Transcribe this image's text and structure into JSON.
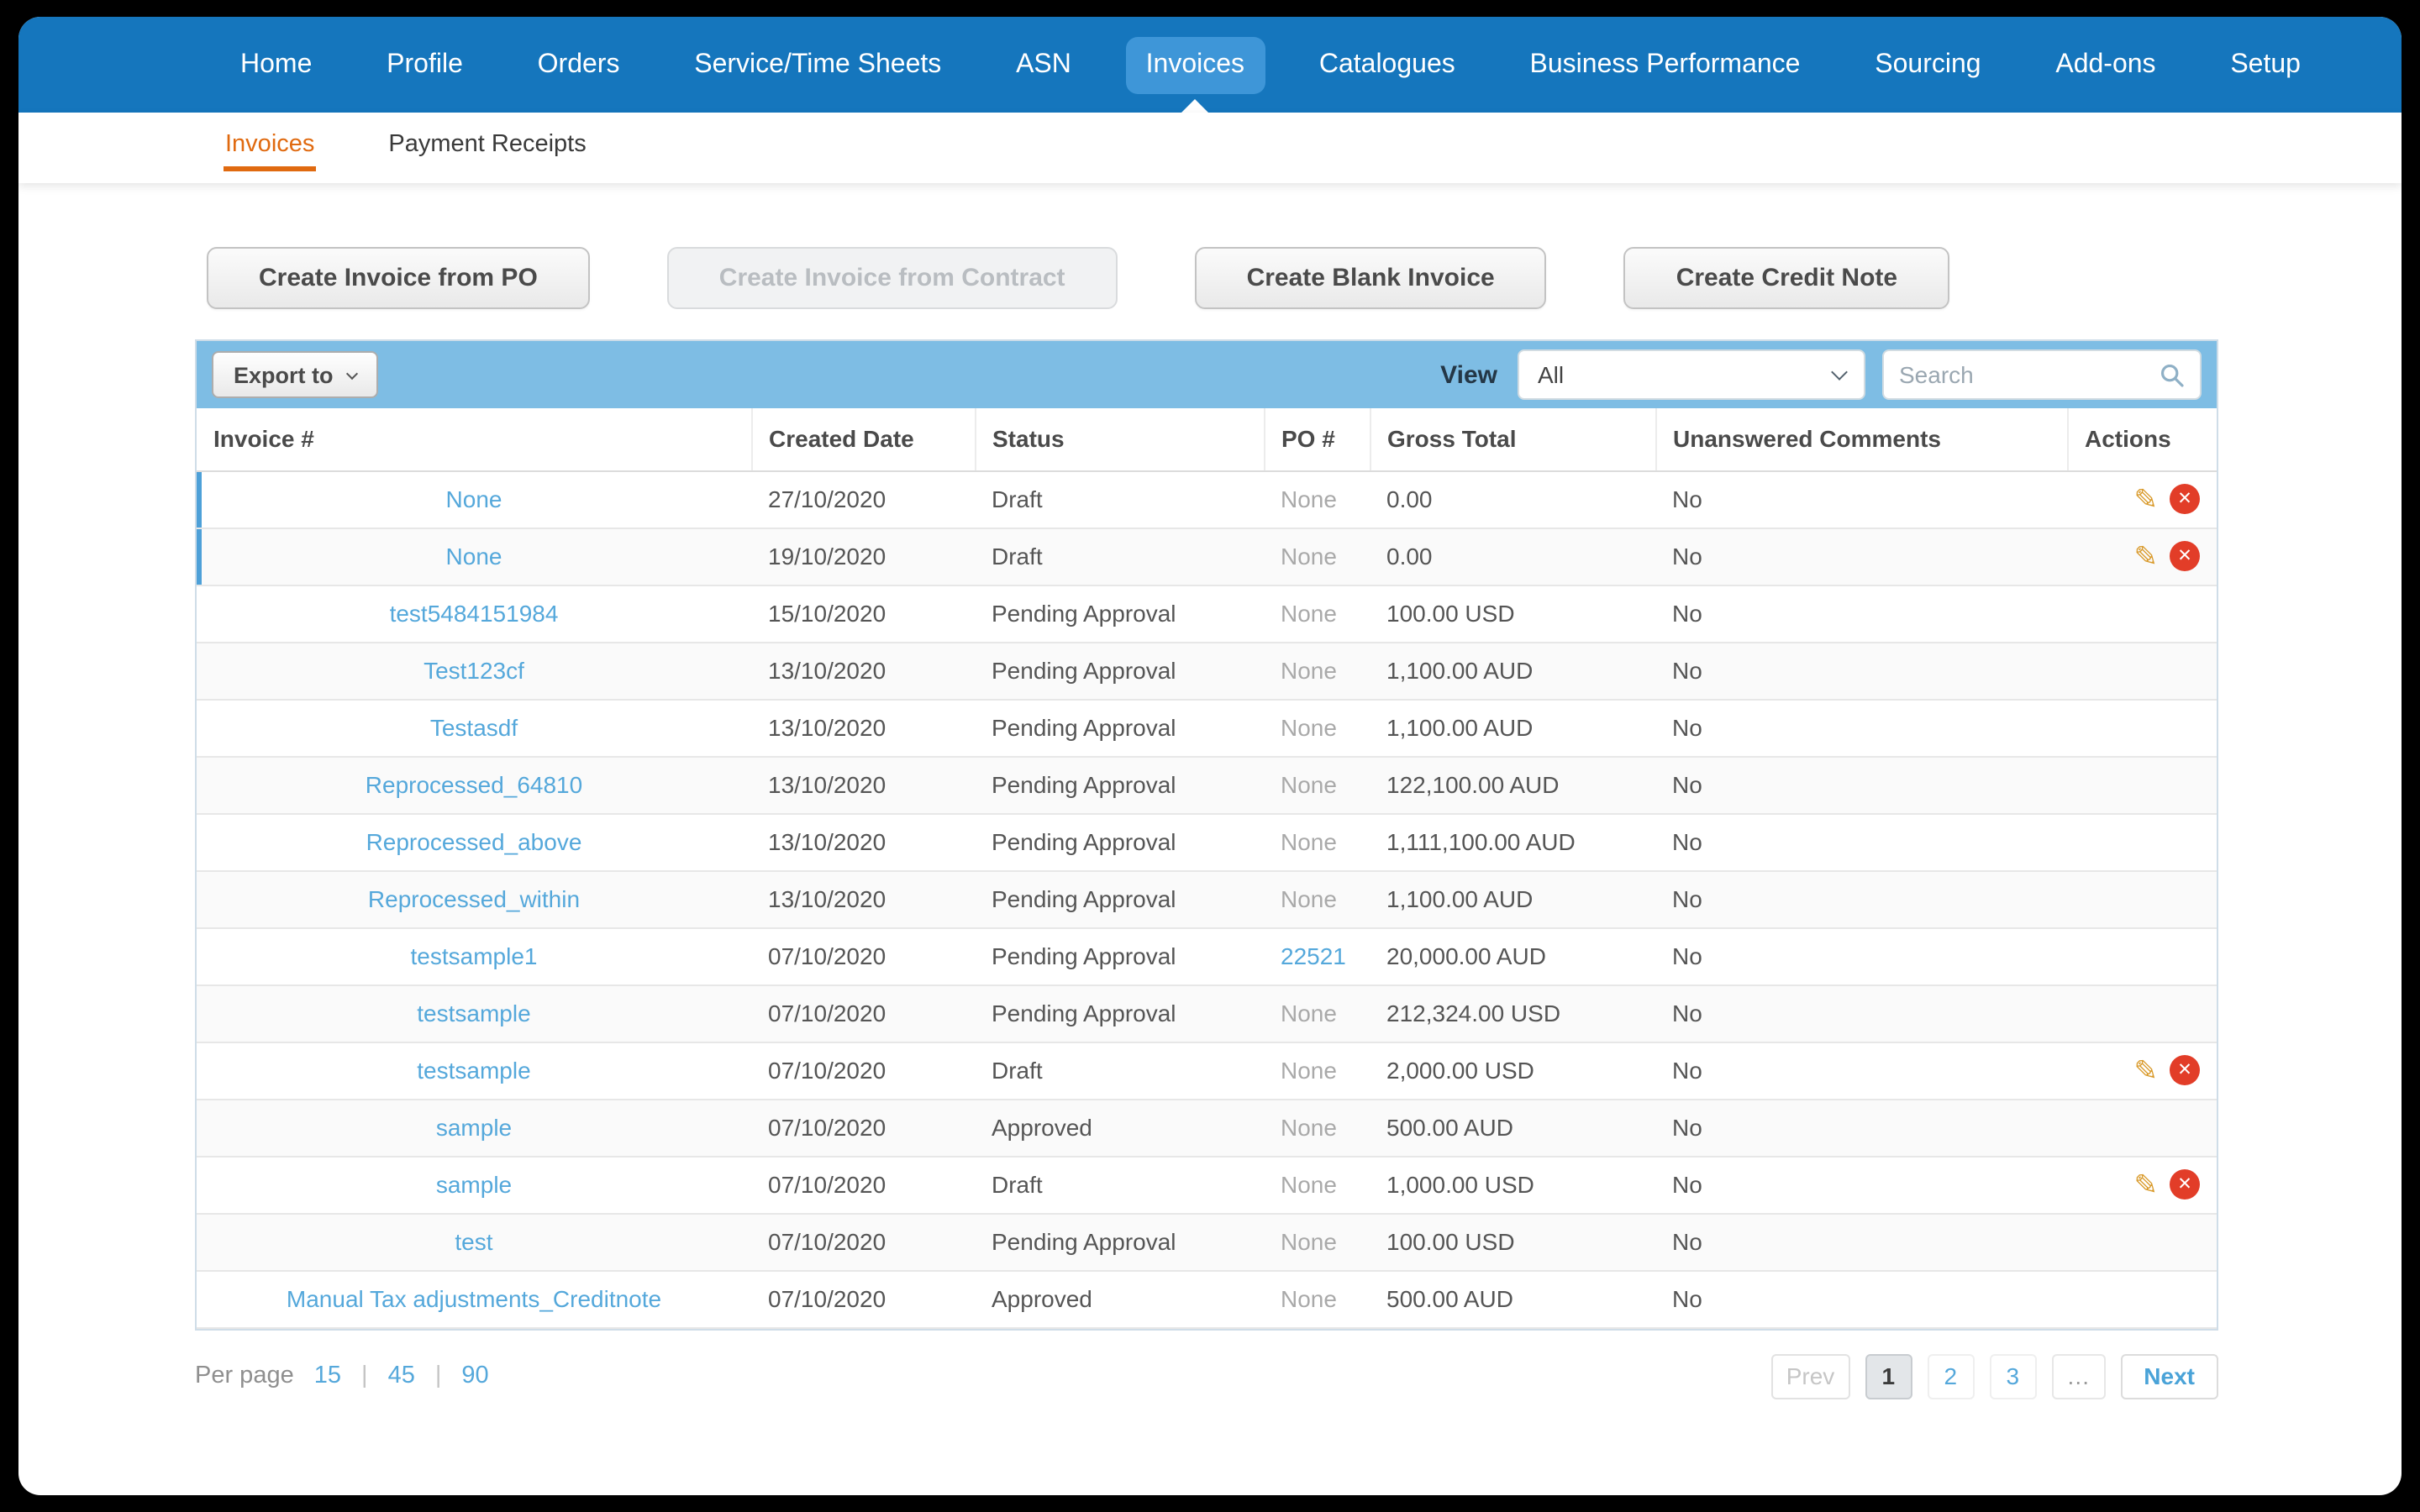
{
  "colors": {
    "nav_blue": "#1576bd",
    "nav_active_blue": "#3e96d8",
    "subnav_active_orange": "#e06a10",
    "link_blue": "#55a8db",
    "toolbar_blue": "#7ebde4",
    "delete_red": "#e23d28",
    "pencil_orange": "#d99a2b"
  },
  "nav": {
    "items": [
      {
        "label": "Home"
      },
      {
        "label": "Profile"
      },
      {
        "label": "Orders"
      },
      {
        "label": "Service/Time Sheets"
      },
      {
        "label": "ASN"
      },
      {
        "label": "Invoices",
        "active": true
      },
      {
        "label": "Catalogues"
      },
      {
        "label": "Business Performance"
      },
      {
        "label": "Sourcing"
      },
      {
        "label": "Add-ons"
      },
      {
        "label": "Setup"
      }
    ]
  },
  "subnav": {
    "items": [
      {
        "label": "Invoices",
        "active": true
      },
      {
        "label": "Payment Receipts"
      }
    ]
  },
  "create_buttons": [
    {
      "label": "Create Invoice from PO",
      "disabled": false
    },
    {
      "label": "Create Invoice from Contract",
      "disabled": true
    },
    {
      "label": "Create Blank Invoice",
      "disabled": false
    },
    {
      "label": "Create Credit Note",
      "disabled": false
    }
  ],
  "toolbar": {
    "export_label": "Export to",
    "view_label": "View",
    "view_value": "All",
    "search_placeholder": "Search"
  },
  "table": {
    "columns": [
      "Invoice #",
      "Created Date",
      "Status",
      "PO #",
      "Gross Total",
      "Unanswered Comments",
      "Actions"
    ],
    "rows": [
      {
        "invoice": "None",
        "created": "27/10/2020",
        "status": "Draft",
        "po": "None",
        "po_is_link": false,
        "gross": "0.00",
        "comments": "No",
        "has_actions": true,
        "highlight": true
      },
      {
        "invoice": "None",
        "created": "19/10/2020",
        "status": "Draft",
        "po": "None",
        "po_is_link": false,
        "gross": "0.00",
        "comments": "No",
        "has_actions": true,
        "highlight": true
      },
      {
        "invoice": "test5484151984",
        "created": "15/10/2020",
        "status": "Pending Approval",
        "po": "None",
        "po_is_link": false,
        "gross": "100.00 USD",
        "comments": "No",
        "has_actions": false,
        "highlight": false
      },
      {
        "invoice": "Test123cf",
        "created": "13/10/2020",
        "status": "Pending Approval",
        "po": "None",
        "po_is_link": false,
        "gross": "1,100.00 AUD",
        "comments": "No",
        "has_actions": false,
        "highlight": false
      },
      {
        "invoice": "Testasdf",
        "created": "13/10/2020",
        "status": "Pending Approval",
        "po": "None",
        "po_is_link": false,
        "gross": "1,100.00 AUD",
        "comments": "No",
        "has_actions": false,
        "highlight": false
      },
      {
        "invoice": "Reprocessed_64810",
        "created": "13/10/2020",
        "status": "Pending Approval",
        "po": "None",
        "po_is_link": false,
        "gross": "122,100.00 AUD",
        "comments": "No",
        "has_actions": false,
        "highlight": false
      },
      {
        "invoice": "Reprocessed_above",
        "created": "13/10/2020",
        "status": "Pending Approval",
        "po": "None",
        "po_is_link": false,
        "gross": "1,111,100.00 AUD",
        "comments": "No",
        "has_actions": false,
        "highlight": false
      },
      {
        "invoice": "Reprocessed_within",
        "created": "13/10/2020",
        "status": "Pending Approval",
        "po": "None",
        "po_is_link": false,
        "gross": "1,100.00 AUD",
        "comments": "No",
        "has_actions": false,
        "highlight": false
      },
      {
        "invoice": "testsample1",
        "created": "07/10/2020",
        "status": "Pending Approval",
        "po": "22521",
        "po_is_link": true,
        "gross": "20,000.00 AUD",
        "comments": "No",
        "has_actions": false,
        "highlight": false
      },
      {
        "invoice": "testsample",
        "created": "07/10/2020",
        "status": "Pending Approval",
        "po": "None",
        "po_is_link": false,
        "gross": "212,324.00 USD",
        "comments": "No",
        "has_actions": false,
        "highlight": false
      },
      {
        "invoice": "testsample",
        "created": "07/10/2020",
        "status": "Draft",
        "po": "None",
        "po_is_link": false,
        "gross": "2,000.00 USD",
        "comments": "No",
        "has_actions": true,
        "highlight": false
      },
      {
        "invoice": "sample",
        "created": "07/10/2020",
        "status": "Approved",
        "po": "None",
        "po_is_link": false,
        "gross": "500.00 AUD",
        "comments": "No",
        "has_actions": false,
        "highlight": false
      },
      {
        "invoice": "sample",
        "created": "07/10/2020",
        "status": "Draft",
        "po": "None",
        "po_is_link": false,
        "gross": "1,000.00 USD",
        "comments": "No",
        "has_actions": true,
        "highlight": false
      },
      {
        "invoice": "test",
        "created": "07/10/2020",
        "status": "Pending Approval",
        "po": "None",
        "po_is_link": false,
        "gross": "100.00 USD",
        "comments": "No",
        "has_actions": false,
        "highlight": false
      },
      {
        "invoice": "Manual Tax adjustments_Creditnote",
        "created": "07/10/2020",
        "status": "Approved",
        "po": "None",
        "po_is_link": false,
        "gross": "500.00 AUD",
        "comments": "No",
        "has_actions": false,
        "highlight": false
      }
    ]
  },
  "footer": {
    "per_page_label": "Per page",
    "per_page_options": [
      "15",
      "45",
      "90"
    ],
    "separator": "|",
    "pagination": [
      {
        "label": "Prev",
        "type": "disabled"
      },
      {
        "label": "1",
        "type": "active"
      },
      {
        "label": "2",
        "type": "link"
      },
      {
        "label": "3",
        "type": "link"
      },
      {
        "label": "…",
        "type": "ellipsis"
      },
      {
        "label": "Next",
        "type": "next"
      }
    ]
  },
  "icons": {
    "edit_glyph": "✎",
    "delete_glyph": "✕",
    "chevron_down": "css-triangle",
    "search": "svg-magnifier"
  }
}
